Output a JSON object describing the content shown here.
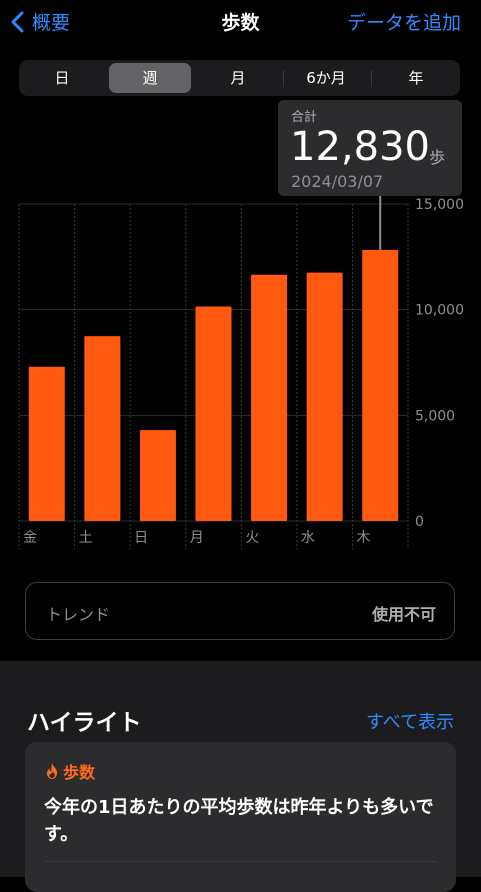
{
  "nav": {
    "back_label": "概要",
    "title": "歩数",
    "add_label": "データを追加"
  },
  "segments": [
    {
      "label": "日",
      "active": false
    },
    {
      "label": "週",
      "active": true
    },
    {
      "label": "月",
      "active": false
    },
    {
      "label": "6か月",
      "active": false
    },
    {
      "label": "年",
      "active": false
    }
  ],
  "tooltip": {
    "label": "合計",
    "value": "12,830",
    "unit": "歩",
    "date": "2024/03/07"
  },
  "chart_data": {
    "type": "bar",
    "categories": [
      "金",
      "土",
      "日",
      "月",
      "火",
      "水",
      "木"
    ],
    "values": [
      7300,
      8750,
      4300,
      10150,
      11650,
      11750,
      12830
    ],
    "ylim": [
      0,
      15000
    ],
    "yticks": [
      "0",
      "5,000",
      "10,000",
      "15,000"
    ],
    "xlabel": "",
    "ylabel": "",
    "selected_index": 6,
    "bar_color": "#FF5A10",
    "grid": true
  },
  "trend": {
    "label": "トレンド",
    "value": "使用不可"
  },
  "highlights": {
    "title": "ハイライト",
    "see_all": "すべて表示",
    "card": {
      "category": "歩数",
      "text": "今年の1日あたりの平均歩数は昨年よりも多いです。"
    }
  }
}
